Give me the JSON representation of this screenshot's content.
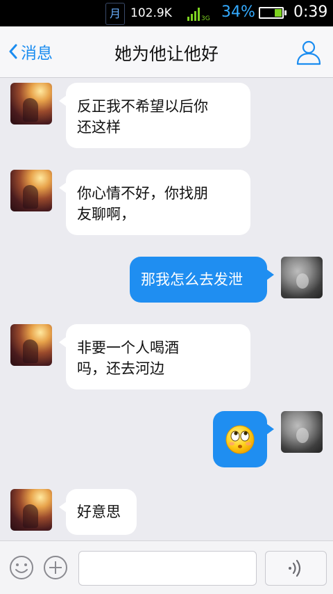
{
  "status_bar": {
    "calendar_glyph": "月",
    "net_speed": "102.9K",
    "network_type": "3G",
    "battery_percent": "34%",
    "battery_level": 0.34,
    "time": "0:39",
    "accent_color": "#33aaff"
  },
  "nav": {
    "back_label": "消息",
    "title": "她为他让他好",
    "profile_icon": "person-icon"
  },
  "messages": [
    {
      "side": "left",
      "lines": [
        "反正我不希望以后你",
        "还这样"
      ]
    },
    {
      "side": "left",
      "lines": [
        "你心情不好，你找朋",
        "友聊啊，"
      ]
    },
    {
      "side": "right",
      "lines": [
        "那我怎么去发泄"
      ]
    },
    {
      "side": "left",
      "lines": [
        "非要一个人喝酒",
        "吗，还去河边"
      ]
    },
    {
      "side": "right",
      "emoji": "rolling-eyes-emoji"
    },
    {
      "side": "left",
      "lines": [
        "好意思"
      ]
    }
  ],
  "input_bar": {
    "emoji_icon": "smiley-icon",
    "plus_icon": "plus-icon",
    "text_value": "",
    "voice_icon": "voice-icon"
  }
}
